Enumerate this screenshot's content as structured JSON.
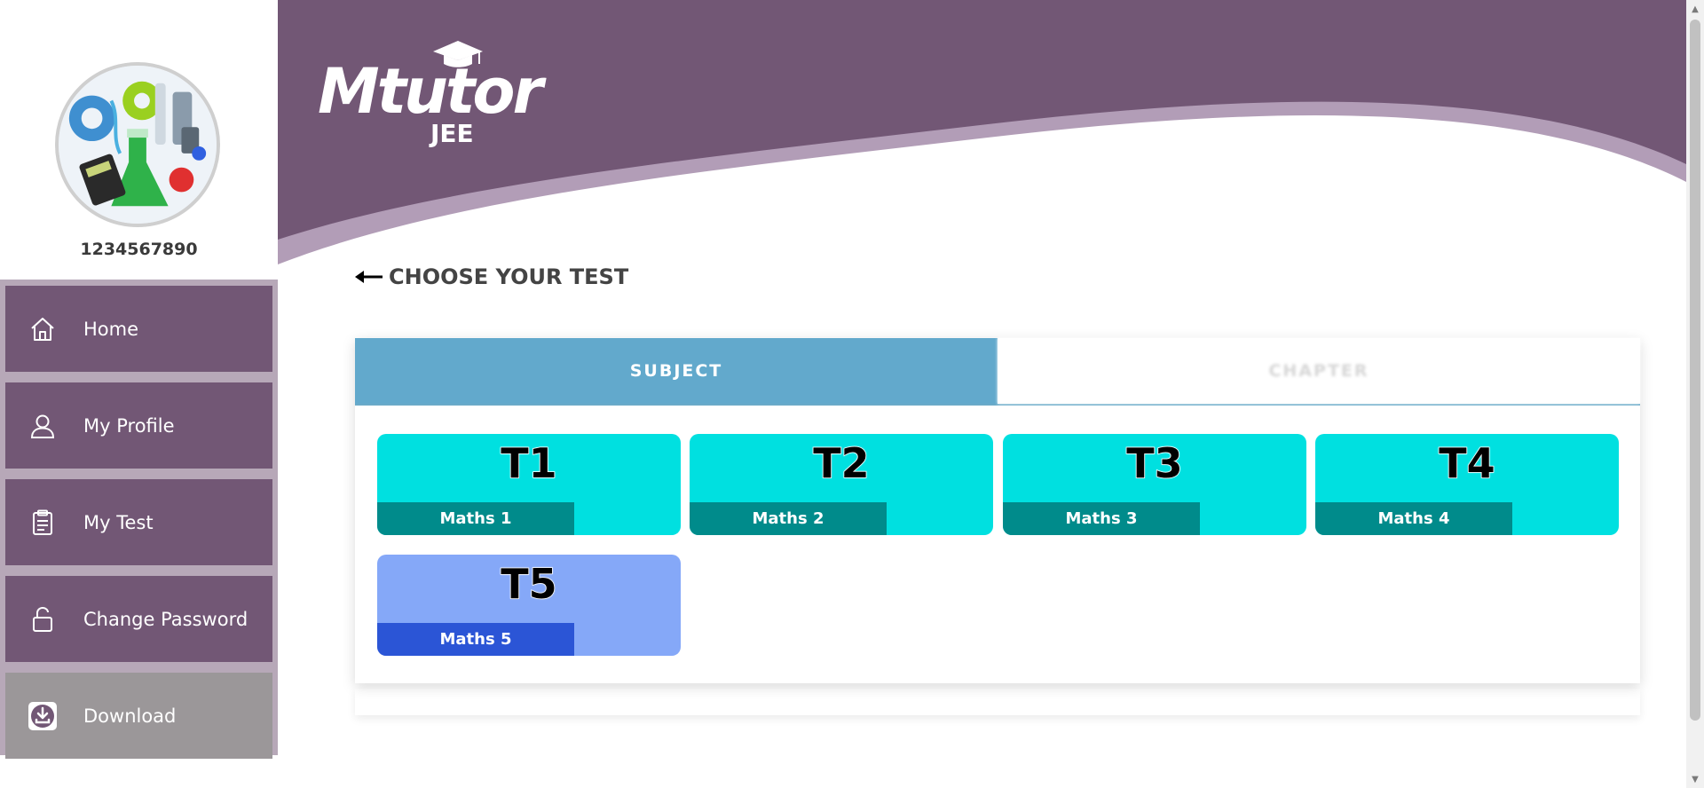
{
  "sidebar": {
    "user_id": "1234567890",
    "menu": [
      {
        "label": "Home",
        "icon": "home-icon"
      },
      {
        "label": "My Profile",
        "icon": "user-icon"
      },
      {
        "label": "My Test",
        "icon": "clipboard-icon"
      },
      {
        "label": "Change Password",
        "icon": "lock-icon"
      },
      {
        "label": "Download",
        "icon": "download-icon"
      }
    ]
  },
  "header": {
    "logo_brand": "Mtutor",
    "logo_sub": "JEE"
  },
  "page": {
    "heading": "CHOOSE YOUR TEST"
  },
  "tabs": [
    {
      "label": "SUBJECT",
      "active": true
    },
    {
      "label": "CHAPTER",
      "active": false
    }
  ],
  "tests": [
    {
      "code": "T1",
      "name": "Maths 1"
    },
    {
      "code": "T2",
      "name": "Maths 2"
    },
    {
      "code": "T3",
      "name": "Maths 3"
    },
    {
      "code": "T4",
      "name": "Maths 4"
    },
    {
      "code": "T5",
      "name": "Maths 5"
    }
  ],
  "colors": {
    "primary_purple": "#725775",
    "menu_bg": "#b7a8b8",
    "download_bg": "#9b9799",
    "tab_active": "#62a9cc",
    "card_cyan": "#00e0e0",
    "card_cyan_label": "#008b8b",
    "card_blue": "#85a8f8",
    "card_blue_label": "#2b55d6"
  }
}
